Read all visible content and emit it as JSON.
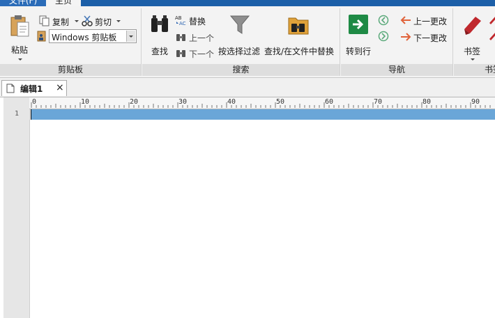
{
  "menubar": {
    "file_label": "文件(F)",
    "active_tab_label": "主页"
  },
  "ribbon": {
    "clipboard": {
      "title": "剪贴板",
      "paste_label": "粘贴",
      "copy_label": "复制",
      "cut_label": "剪切",
      "clipboard_select_value": "Windows 剪贴板"
    },
    "search": {
      "title": "搜索",
      "find_label": "查找",
      "replace_label": "替换",
      "prev_label": "上一个",
      "next_label": "下一个",
      "filter_label": "按选择过滤",
      "find_in_files_label": "查找/在文件中替换"
    },
    "navigation": {
      "title": "导航",
      "goto_label": "转到行",
      "prev_change_label": "上一更改",
      "next_change_label": "下一更改"
    },
    "bookmarks": {
      "title": "书签",
      "bookmark_label": "书签"
    }
  },
  "tabs": [
    {
      "label": "编辑1",
      "close": "×"
    }
  ],
  "ruler": {
    "labels": [
      "0",
      "10",
      "20",
      "30",
      "40",
      "50",
      "60",
      "70",
      "80",
      "90"
    ]
  },
  "editor": {
    "line_numbers": [
      "1"
    ]
  },
  "colors": {
    "accent": "#1c5fa8",
    "current_line": "#6aa6d8",
    "goto_green": "#1e8a45",
    "arrow_orange": "#e0623a",
    "bookmark_red": "#c0282d"
  }
}
